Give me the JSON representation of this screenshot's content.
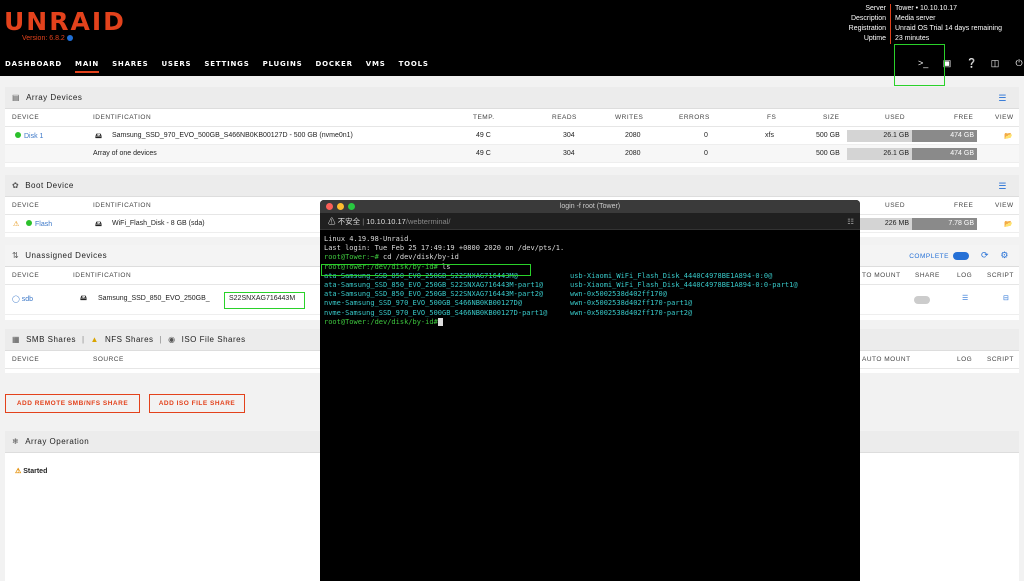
{
  "header": {
    "logo": "UNRAID",
    "version": "Version: 6.8.2",
    "server_info": [
      {
        "k": "Server",
        "v": "Tower • 10.10.10.17"
      },
      {
        "k": "Description",
        "v": "Media server"
      },
      {
        "k": "Registration",
        "v": "Unraid OS Trial 14 days remaining"
      },
      {
        "k": "Uptime",
        "v": "23 minutes"
      }
    ]
  },
  "nav": [
    "DASHBOARD",
    "MAIN",
    "SHARES",
    "USERS",
    "SETTINGS",
    "PLUGINS",
    "DOCKER",
    "VMS",
    "TOOLS"
  ],
  "nav_active": "MAIN",
  "top_icons": [
    "terminal-icon",
    "feedback-icon",
    "help-icon",
    "log-icon",
    "power-icon"
  ],
  "array_devices": {
    "title": "Array Devices",
    "columns": [
      "DEVICE",
      "IDENTIFICATION",
      "TEMP.",
      "READS",
      "WRITES",
      "ERRORS",
      "FS",
      "SIZE",
      "USED",
      "FREE",
      "VIEW"
    ],
    "rows": [
      {
        "device": "Disk 1",
        "identification": "Samsung_SSD_970_EVO_500GB_S466NB0KB00127D - 500 GB (nvme0n1)",
        "temp": "49 C",
        "reads": "304",
        "writes": "2080",
        "errors": "0",
        "fs": "xfs",
        "size": "500 GB",
        "used": "26.1 GB",
        "free": "474 GB"
      },
      {
        "device": "",
        "identification": "Array of one devices",
        "temp": "49 C",
        "reads": "304",
        "writes": "2080",
        "errors": "0",
        "fs": "",
        "size": "500 GB",
        "used": "26.1 GB",
        "free": "474 GB"
      }
    ]
  },
  "boot_device": {
    "title": "Boot Device",
    "columns": [
      "DEVICE",
      "IDENTIFICATION",
      "USED",
      "FREE",
      "VIEW"
    ],
    "row": {
      "device": "Flash",
      "identification": "WiFi_Flash_Disk - 8 GB (sda)",
      "used": "226 MB",
      "free": "7.78 GB"
    }
  },
  "unassigned": {
    "title": "Unassigned Devices",
    "complete": "COMPLETE",
    "columns": [
      "DEVICE",
      "IDENTIFICATION",
      "TO MOUNT",
      "SHARE",
      "LOG",
      "SCRIPT"
    ],
    "row": {
      "device": "sdb",
      "identification": "Samsung_SSD_850_EVO_250GB_",
      "serial": "S22SNXAG716443M"
    }
  },
  "shares": {
    "tabs": [
      "SMB Shares",
      "NFS Shares",
      "ISO File Shares"
    ],
    "columns": [
      "DEVICE",
      "SOURCE",
      "AUTO MOUNT",
      "LOG",
      "SCRIPT"
    ]
  },
  "buttons": {
    "add_remote": "ADD REMOTE SMB/NFS SHARE",
    "add_iso": "ADD ISO FILE SHARE"
  },
  "array_operation": {
    "title": "Array Operation",
    "status": "Started"
  },
  "terminal": {
    "title": "login -f root (Tower)",
    "insecure": "不安全",
    "host": "10.10.10.17",
    "path": "/webterminal/",
    "lines": [
      {
        "t": "Linux 4.19.98-Unraid."
      },
      {
        "t": "Last login: Tue Feb 25 17:49:19 +0800 2020 on /dev/pts/1."
      },
      {
        "p": "root@Tower:~#",
        "t": " cd /dev/disk/by-id"
      },
      {
        "p": "root@Tower:/dev/disk/by-id#",
        "t": " ls"
      },
      {
        "a": "ata-Samsung_SSD_850_EVO_250GB_S22SNXAG716443M@",
        "b": "usb-Xiaomi_WiFi_Flash_Disk_4440C4978BE1A894-0:0@"
      },
      {
        "a": "ata-Samsung_SSD_850_EVO_250GB_S22SNXAG716443M-part1@",
        "b": "usb-Xiaomi_WiFi_Flash_Disk_4440C4978BE1A894-0:0-part1@"
      },
      {
        "a": "ata-Samsung_SSD_850_EVO_250GB_S22SNXAG716443M-part2@",
        "b": "wwn-0x5002538d402ff170@"
      },
      {
        "a": "nvme-Samsung_SSD_970_EVO_500GB_S466NB0KB00127D@",
        "b": "wwn-0x5002538d402ff170-part1@"
      },
      {
        "a": "nvme-Samsung_SSD_970_EVO_500GB_S466NB0KB00127D-part1@",
        "b": "wwn-0x5002538d402ff170-part2@"
      },
      {
        "p": "root@Tower:/dev/disk/by-id#",
        "t": " "
      }
    ]
  },
  "colors": {
    "accent": "#e3421c",
    "highlight": "#2ad12a",
    "terminal_cyan": "#38c8c8",
    "prompt": "#3ec63e"
  }
}
